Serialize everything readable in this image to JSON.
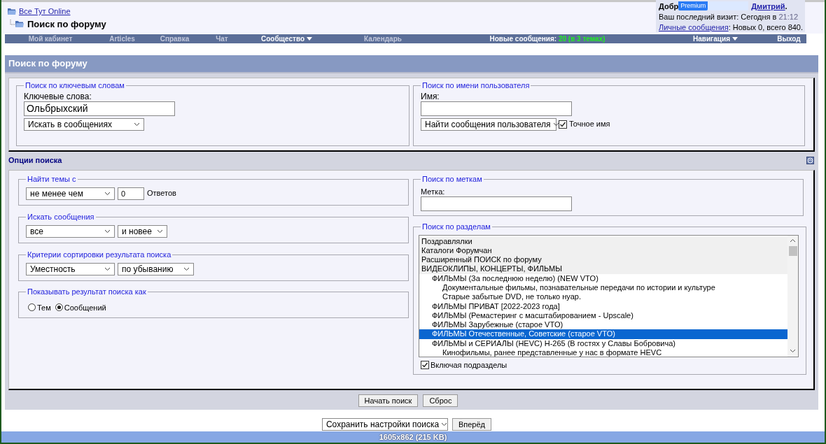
{
  "breadcrumb": {
    "parent": "Все Тут Online",
    "current": "Поиск по форуму"
  },
  "welcome": {
    "greeting_start": "Добр",
    "overlay_badge": "Premium",
    "user": "Дмитрий",
    "greeting_end": ".",
    "last_visit_label": "Ваш последний визит: Сегодня в ",
    "last_visit_time": "21:12",
    "pm_link": "Личные сообщения",
    "pm_text": ": Новых 0, всего 840."
  },
  "navbar": [
    {
      "kind": "link",
      "label": "Мой кабинет"
    },
    {
      "kind": "link",
      "label": "Articles"
    },
    {
      "kind": "link",
      "label": "Справка"
    },
    {
      "kind": "link",
      "label": "Чат"
    },
    {
      "kind": "menu",
      "label": "Сообщество"
    },
    {
      "kind": "link",
      "label": "Календарь"
    },
    {
      "kind": "new",
      "label": "Новые сообщения: ",
      "count": "20 (в 3 темах)"
    },
    {
      "kind": "menu",
      "label": "Навигация"
    },
    {
      "kind": "action",
      "label": "Выход"
    }
  ],
  "page_title": "Поиск по форуму",
  "keyword_search": {
    "legend": "Поиск по ключевым словам",
    "label": "Ключевые слова:",
    "value": "Ольбрыхский",
    "mode": "Искать в сообщениях"
  },
  "user_search": {
    "legend": "Поиск по имени пользователя",
    "label": "Имя:",
    "mode": "Найти сообщения пользователя",
    "exact": {
      "label": "Точное имя",
      "checked": true
    }
  },
  "options_title": "Опции поиска",
  "find_topics": {
    "legend": "Найти темы с",
    "comparison": "не менее чем",
    "count": "0",
    "unit": "Ответов"
  },
  "find_posts": {
    "legend": "Искать сообщения",
    "period": "все",
    "direction": "и новее"
  },
  "sort": {
    "legend": "Критерии сортировки результата поиска",
    "field": "Уместность",
    "order": "по убыванию"
  },
  "show_as": {
    "legend": "Показывать результат поиска как",
    "options": [
      {
        "label": "Тем",
        "selected": false
      },
      {
        "label": "Сообщений",
        "selected": true
      }
    ]
  },
  "tag_search": {
    "legend": "Поиск по меткам",
    "label": "Метка:"
  },
  "section_search": {
    "legend": "Поиск по разделам",
    "sections": [
      {
        "label": "Поздравлялки",
        "selected": false
      },
      {
        "label": "Каталоги Форумчан",
        "selected": false
      },
      {
        "label": "Расширенный ПОИСК по форуму",
        "selected": false
      },
      {
        "label": "ВИДЕОКЛИПЫ, КОНЦЕРТЫ, ФИЛЬМЫ",
        "selected": false,
        "children": [
          {
            "label": "ФИЛЬМЫ (За последнюю неделю) (NEW VTO)",
            "selected": false,
            "children": [
              {
                "label": "Документальные фильмы, познавательные передачи по истории и культуре",
                "selected": false
              },
              {
                "label": "Старые забытые DVD, не только нуар.",
                "selected": false
              }
            ]
          },
          {
            "label": "ФИЛЬМЫ ПРИВАТ [2022-2023 года]",
            "selected": false
          },
          {
            "label": "ФИЛЬМЫ (Ремастеринг с масштабированием - Upscale)",
            "selected": false
          },
          {
            "label": "ФИЛЬМЫ Зарубежные (старое VTO)",
            "selected": false
          },
          {
            "label": "ФИЛЬМЫ Отечественные, Советские (старое VTO)",
            "selected": true
          },
          {
            "label": "ФИЛЬМЫ и СЕРИАЛЫ (HEVC) H-265 (В гостях у Славы Бобровича)",
            "selected": false,
            "children": [
              {
                "label": "Кинофильмы, ранее представленные у нас в формате HEVC",
                "selected": false
              }
            ]
          }
        ]
      }
    ],
    "include_subsections": {
      "label": "Включая подразделы",
      "checked": true
    }
  },
  "buttons": [
    "Начать поиск",
    "Сброс"
  ],
  "save_settings": "Сохранить настройки поиска",
  "forward_button": "Вперёд",
  "viewer_caption": "1605x862 (215 KB)"
}
